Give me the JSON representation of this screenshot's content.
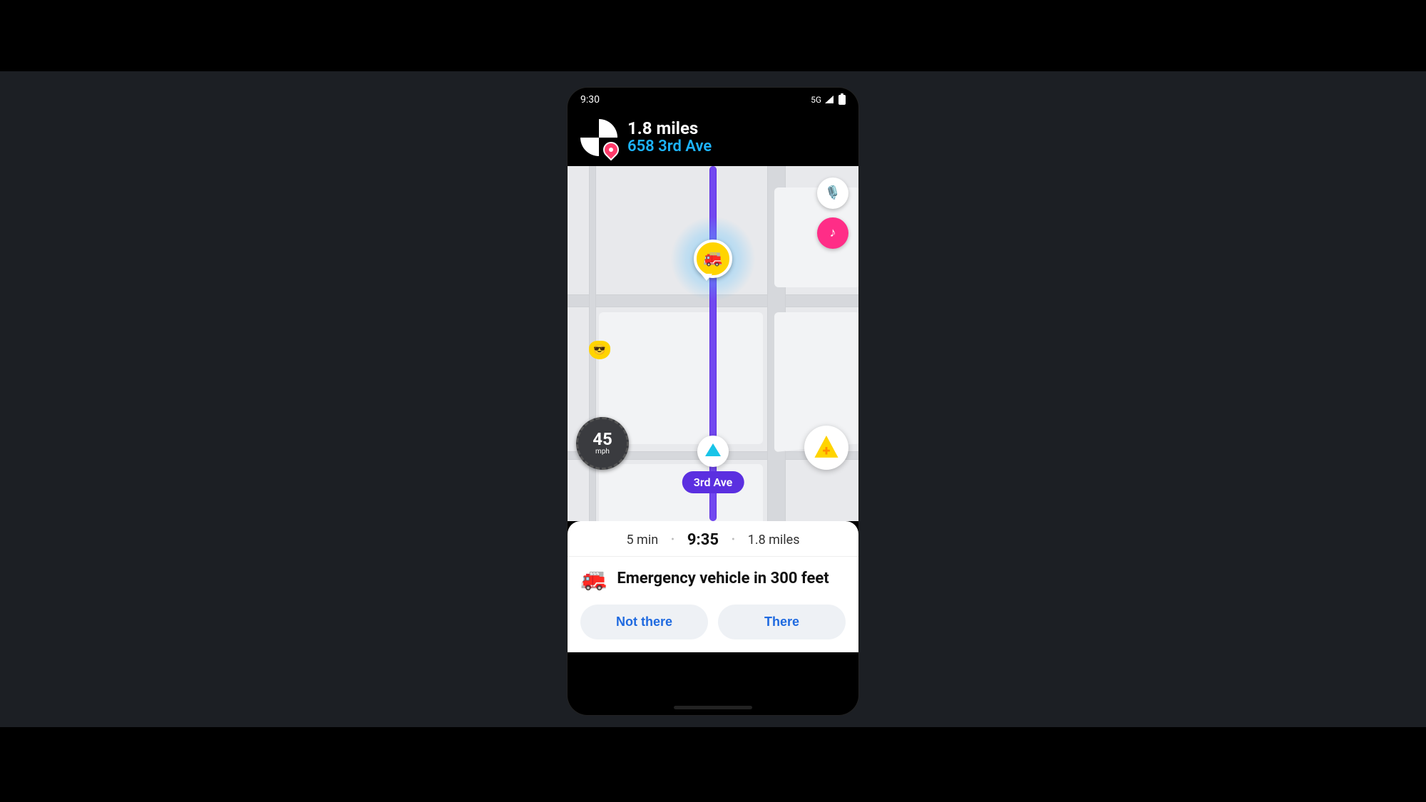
{
  "status": {
    "time": "9:30",
    "network": "5G"
  },
  "destination": {
    "distance": "1.8 miles",
    "address": "658 3rd Ave"
  },
  "map": {
    "street_label": "3rd Ave",
    "speed_limit": {
      "value": "45",
      "unit": "mph"
    }
  },
  "eta": {
    "duration": "5 min",
    "arrival": "9:35",
    "distance": "1.8 miles"
  },
  "alert": {
    "text": "Emergency vehicle in 300 feet",
    "icon": "🚒"
  },
  "buttons": {
    "not_there": "Not there",
    "there": "There"
  }
}
